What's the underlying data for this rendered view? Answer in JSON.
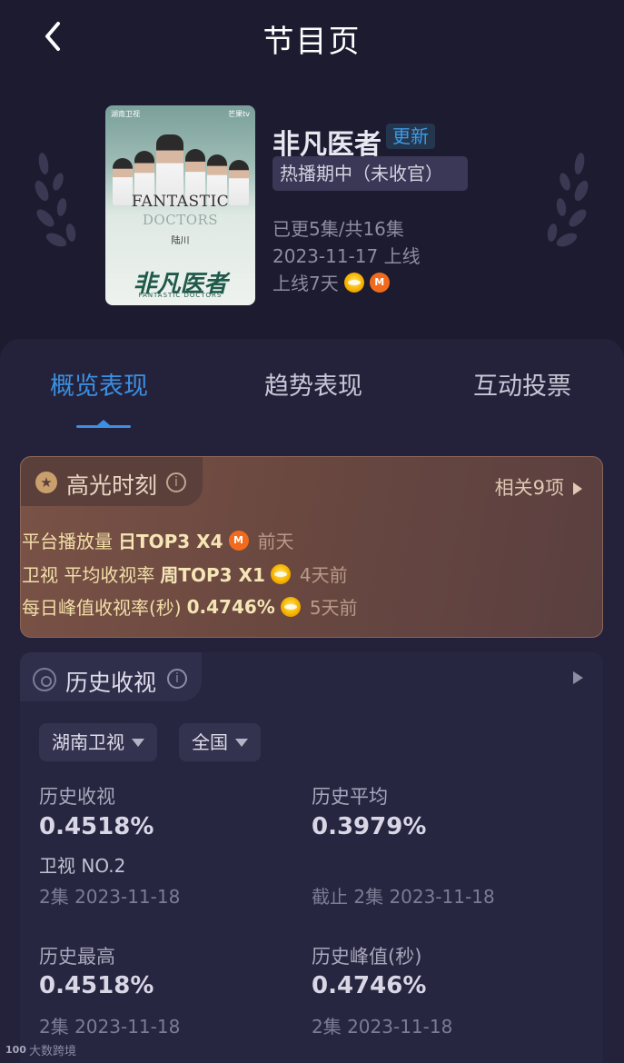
{
  "header": {
    "title": "节目页"
  },
  "show": {
    "name": "非凡医者",
    "update_badge": "更新",
    "status": "热播期中（未收官）",
    "episodes": "已更5集/共16集",
    "release": "2023-11-17 上线",
    "days_online": "上线7天",
    "platform_icons": [
      "hunan-tv-icon",
      "mango-tv-icon"
    ]
  },
  "poster": {
    "logo_left": "湖南卫视",
    "logo_right": "芒果tv",
    "en_title_1": "FANTASTIC",
    "en_title_2": "DOCTORS",
    "actor": "陆川",
    "cn_title": "非凡医者",
    "en_sub": "FANTASTIC DOCTORS"
  },
  "tabs": [
    {
      "label": "概览表现",
      "active": true
    },
    {
      "label": "趋势表现",
      "active": false
    },
    {
      "label": "互动投票",
      "active": false
    }
  ],
  "highlights": {
    "title": "高光时刻",
    "more": "相关9项",
    "rows": [
      {
        "label": "平台播放量",
        "value": "日TOP3 X4",
        "icon": "mango-tv-icon",
        "ago": "前天"
      },
      {
        "label": "卫视 平均收视率",
        "value": "周TOP3 X1",
        "icon": "hunan-tv-icon",
        "ago": "4天前"
      },
      {
        "label": "每日峰值收视率(秒)",
        "value": "0.4746%",
        "icon": "hunan-tv-icon",
        "ago": "5天前"
      }
    ]
  },
  "history": {
    "title": "历史收视",
    "filters": [
      "湖南卫视",
      "全国"
    ],
    "stats": {
      "hist_rating": {
        "label": "历史收视",
        "value": "0.4518%",
        "rank": "卫视 NO.2",
        "sub": "2集 2023-11-18"
      },
      "hist_avg": {
        "label": "历史平均",
        "value": "0.3979%",
        "sub": "截止 2集 2023-11-18"
      },
      "hist_max": {
        "label": "历史最高",
        "value": "0.4518%",
        "sub": "2集 2023-11-18"
      },
      "hist_peak": {
        "label": "历史峰值(秒)",
        "value": "0.4746%",
        "sub": "2集 2023-11-18"
      }
    }
  },
  "watermark": {
    "text": "大数跨境",
    "logo": "100"
  },
  "colors": {
    "background": "#1d1b2f",
    "accent": "#3d8fe0",
    "highlight_card": "#6a4840",
    "gold_text": "#f2dfa8"
  }
}
